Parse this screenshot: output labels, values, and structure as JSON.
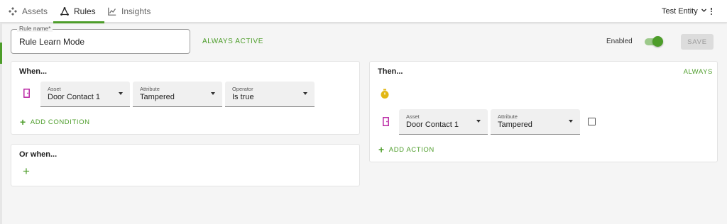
{
  "nav": {
    "tabs": [
      {
        "label": "Assets",
        "icon": "assets-icon"
      },
      {
        "label": "Rules",
        "icon": "rules-icon",
        "active": true
      },
      {
        "label": "Insights",
        "icon": "insights-icon"
      }
    ],
    "entity": "Test Entity"
  },
  "rule": {
    "name_label": "Rule name*",
    "name_value": "Rule Learn Mode",
    "schedule_label": "ALWAYS ACTIVE",
    "enabled_label": "Enabled",
    "enabled": true,
    "save_label": "SAVE"
  },
  "when": {
    "title": "When...",
    "condition": {
      "asset_label": "Asset",
      "asset_value": "Door Contact 1",
      "attribute_label": "Attribute",
      "attribute_value": "Tampered",
      "operator_label": "Operator",
      "operator_value": "Is true"
    },
    "add_label": "ADD CONDITION"
  },
  "or_when": {
    "title": "Or when..."
  },
  "then": {
    "title": "Then...",
    "frequency_label": "ALWAYS",
    "action": {
      "asset_label": "Asset",
      "asset_value": "Door Contact 1",
      "attribute_label": "Attribute",
      "attribute_value": "Tampered",
      "checked": false
    },
    "add_label": "ADD ACTION"
  },
  "colors": {
    "accent": "#4d9d2a",
    "door_icon": "#b5179e",
    "timer_icon": "#e2b714"
  }
}
